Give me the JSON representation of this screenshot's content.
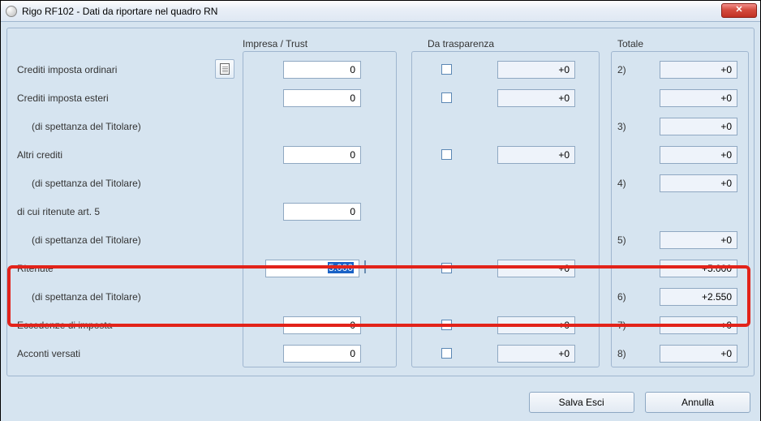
{
  "window": {
    "title": "Rigo RF102 - Dati da riportare nel quadro RN",
    "close": "✕"
  },
  "headers": {
    "impresa": "Impresa / Trust",
    "trasparenza": "Da trasparenza",
    "totale": "Totale"
  },
  "rows": {
    "crediti_ord": {
      "label": "Crediti imposta ordinari",
      "impresa": "0",
      "trasp": "+0",
      "tot_label": "2)",
      "tot": "+0"
    },
    "crediti_est": {
      "label": "Crediti imposta esteri",
      "impresa": "0",
      "trasp": "+0",
      "tot": "+0"
    },
    "crediti_est_sp": {
      "label": "(di spettanza del Titolare)",
      "tot_label": "3)",
      "tot": "+0"
    },
    "altri_crediti": {
      "label": "Altri crediti",
      "impresa": "0",
      "trasp": "+0",
      "tot": "+0"
    },
    "altri_crediti_sp": {
      "label": "(di spettanza del Titolare)",
      "tot_label": "4)",
      "tot": "+0"
    },
    "ritenute5": {
      "label": "di cui ritenute art. 5",
      "impresa": "0"
    },
    "ritenute5_sp": {
      "label": "(di spettanza del Titolare)",
      "tot_label": "5)",
      "tot": "+0"
    },
    "ritenute": {
      "label": "Ritenute",
      "impresa": "5.000",
      "trasp": "+0",
      "tot": "+5.000"
    },
    "ritenute_sp": {
      "label": "(di spettanza del Titolare)",
      "tot_label": "6)",
      "tot": "+2.550"
    },
    "eccedenze": {
      "label": "Eccedenze di imposta",
      "impresa": "0",
      "trasp": "+0",
      "tot_label": "7)",
      "tot": "+0"
    },
    "acconti": {
      "label": "Acconti versati",
      "impresa": "0",
      "trasp": "+0",
      "tot_label": "8)",
      "tot": "+0"
    }
  },
  "buttons": {
    "salva": "Salva Esci",
    "annulla": "Annulla"
  }
}
